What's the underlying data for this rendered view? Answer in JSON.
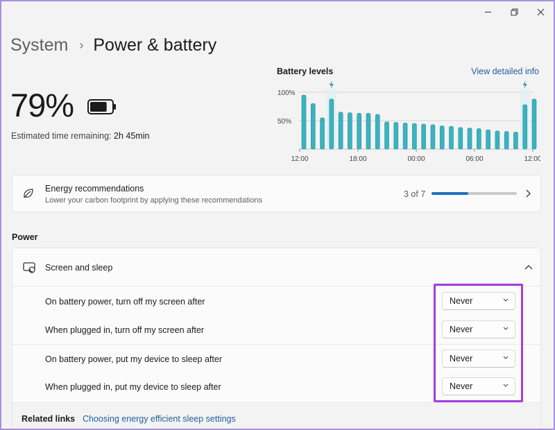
{
  "window": {
    "controls": [
      "minimize-icon",
      "maximize-icon",
      "close-icon"
    ]
  },
  "breadcrumb": {
    "parent": "System",
    "separator": "›",
    "current": "Power & battery"
  },
  "battery": {
    "percentage": "79%",
    "level": 0.79,
    "estimate_label": "Estimated time remaining:",
    "estimate_value": "2h 45min"
  },
  "chart": {
    "title": "Battery levels",
    "link": "View detailed info",
    "y_ticks": [
      "100%",
      "50%"
    ],
    "x_ticks": [
      "12:00",
      "18:00",
      "00:00",
      "06:00",
      "12:00"
    ]
  },
  "chart_data": {
    "type": "bar",
    "title": "Battery levels",
    "ylim": [
      0,
      100
    ],
    "x_tick_labels": [
      "12:00",
      "18:00",
      "00:00",
      "06:00",
      "12:00"
    ],
    "values": [
      95,
      80,
      55,
      88,
      65,
      64,
      63,
      63,
      61,
      48,
      47,
      46,
      45,
      44,
      43,
      41,
      40,
      38,
      37,
      36,
      34,
      32,
      31,
      30,
      78,
      88
    ],
    "charging_markers": [
      3,
      24
    ],
    "color": "#3ab3c0"
  },
  "energy": {
    "title": "Energy recommendations",
    "subtitle": "Lower your carbon footprint by applying these recommendations",
    "count": "3 of 7",
    "progress": 0.43
  },
  "power": {
    "section_label": "Power",
    "group_title": "Screen and sleep",
    "rows": [
      {
        "label": "On battery power, turn off my screen after",
        "value": "Never"
      },
      {
        "label": "When plugged in, turn off my screen after",
        "value": "Never"
      },
      {
        "label": "On battery power, put my device to sleep after",
        "value": "Never"
      },
      {
        "label": "When plugged in, put my device to sleep after",
        "value": "Never"
      }
    ]
  },
  "related": {
    "heading": "Related links",
    "link": "Choosing energy efficient sleep settings"
  },
  "colors": {
    "accent": "#1f6fc0",
    "link": "#1f5f9e",
    "bars": "#3ab3c0",
    "highlight": "#a53cdf"
  }
}
